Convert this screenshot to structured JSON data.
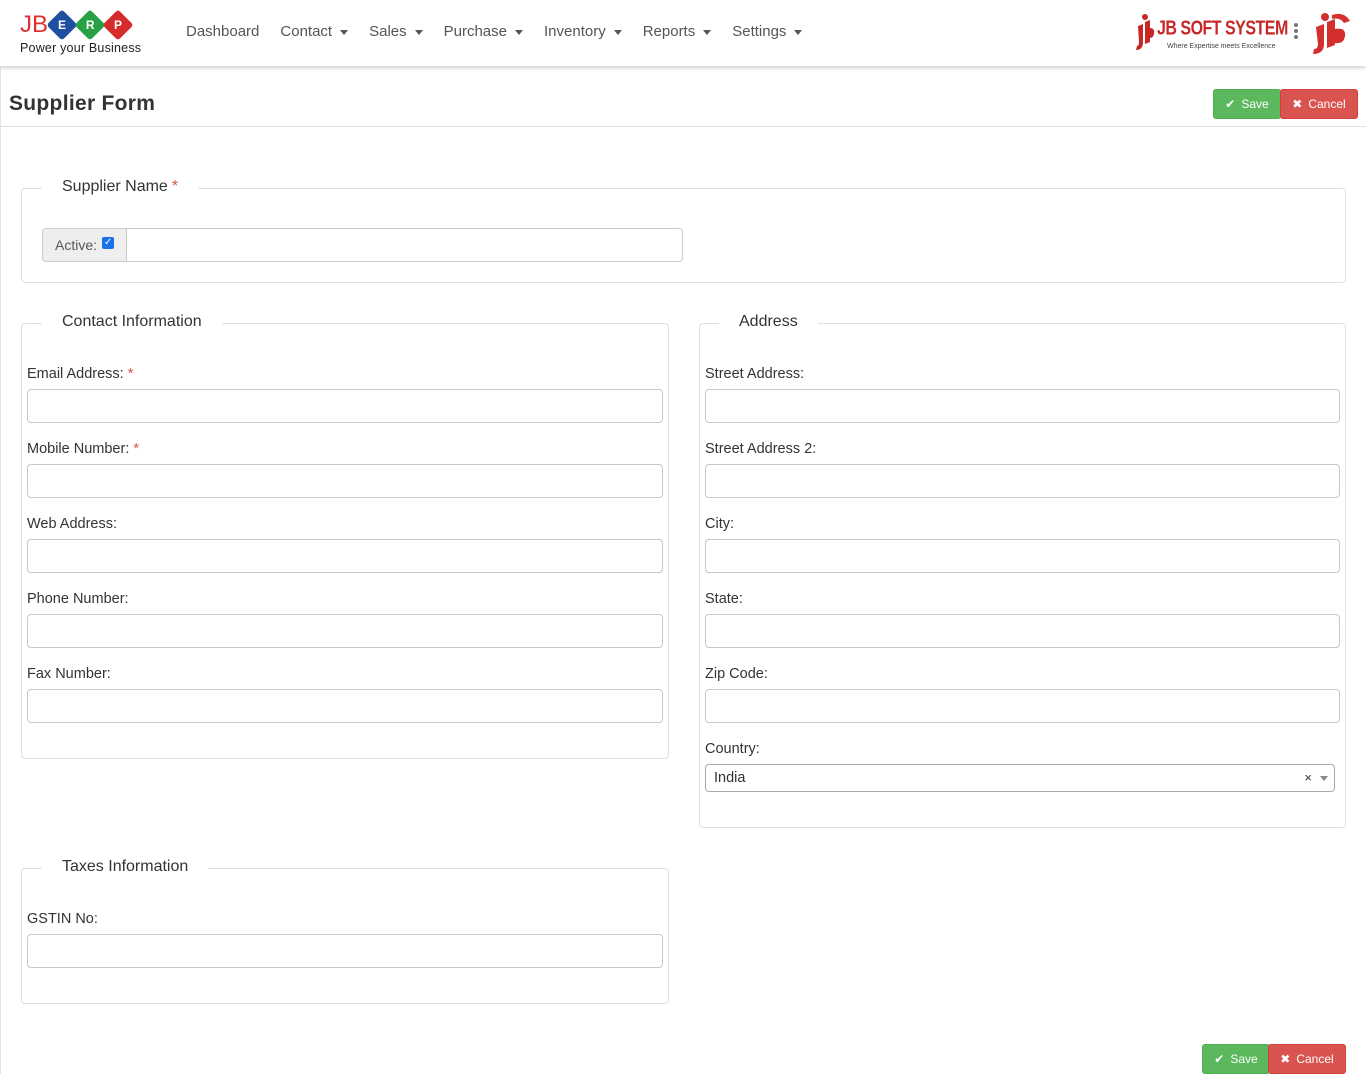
{
  "brand": {
    "jb": "JB",
    "letters": [
      "E",
      "R",
      "P"
    ],
    "tagline": "Power your Business"
  },
  "nav": {
    "items": [
      {
        "label": "Dashboard",
        "has_caret": false
      },
      {
        "label": "Contact",
        "has_caret": true
      },
      {
        "label": "Sales",
        "has_caret": true
      },
      {
        "label": "Purchase",
        "has_caret": true
      },
      {
        "label": "Inventory",
        "has_caret": true
      },
      {
        "label": "Reports",
        "has_caret": true
      },
      {
        "label": "Settings",
        "has_caret": true
      }
    ]
  },
  "company_logo": {
    "name": "JB SOFT SYSTEM",
    "tagline": "Where Expertise meets Excellence"
  },
  "page": {
    "title": "Supplier Form"
  },
  "actions": {
    "save_label": "Save",
    "cancel_label": "Cancel"
  },
  "supplier": {
    "legend": "Supplier Name",
    "required_mark": "*",
    "active_label": "Active:",
    "active_checked": true,
    "name_value": ""
  },
  "contact": {
    "legend": "Contact Information",
    "email_label": "Email Address:",
    "mobile_label": "Mobile Number:",
    "web_label": "Web Address:",
    "phone_label": "Phone Number:",
    "fax_label": "Fax Number:",
    "required_mark": "*"
  },
  "address": {
    "legend": "Address",
    "street_label": "Street Address:",
    "street2_label": "Street Address 2:",
    "city_label": "City:",
    "state_label": "State:",
    "zip_label": "Zip Code:",
    "country_label": "Country:",
    "country_value": "India",
    "clear_glyph": "×"
  },
  "taxes": {
    "legend": "Taxes Information",
    "gstin_label": "GSTIN No:"
  },
  "colors": {
    "save": "#5cb85c",
    "cancel": "#d9534f",
    "required": "#d9534f",
    "brand_red": "#e03030",
    "brand_blue": "#1f4fa0",
    "brand_green": "#27a046"
  },
  "icons": {
    "save": "check-icon",
    "cancel": "times-icon",
    "menu": "kebab-icon"
  }
}
